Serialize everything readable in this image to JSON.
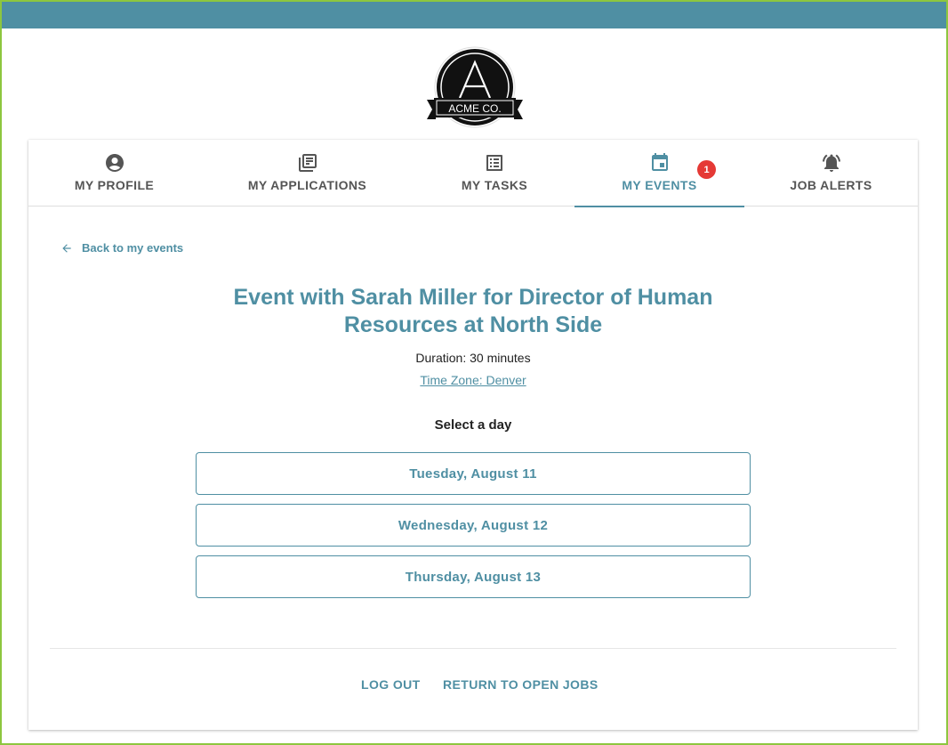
{
  "logo": {
    "name": "ACME CO.",
    "letter": "A"
  },
  "tabs": [
    {
      "label": "MY PROFILE",
      "icon": "account-circle-icon"
    },
    {
      "label": "MY APPLICATIONS",
      "icon": "library-books-icon"
    },
    {
      "label": "MY TASKS",
      "icon": "list-alt-icon"
    },
    {
      "label": "MY EVENTS",
      "icon": "calendar-icon",
      "active": true,
      "badge": "1"
    },
    {
      "label": "JOB ALERTS",
      "icon": "alarm-bell-icon"
    }
  ],
  "back_link": "Back to my events",
  "event": {
    "title": "Event with Sarah Miller for Director of Human Resources at North Side",
    "duration": "Duration: 30 minutes",
    "timezone": "Time Zone: Denver"
  },
  "select_day_label": "Select a day",
  "days": [
    "Tuesday, August 11",
    "Wednesday, August 12",
    "Thursday, August 13"
  ],
  "footer": {
    "logout": "LOG OUT",
    "return": "RETURN TO OPEN JOBS"
  },
  "colors": {
    "accent": "#4f8fa3",
    "badge": "#e53935",
    "frame": "#8dc63f",
    "topbar": "#4f8fa3"
  }
}
